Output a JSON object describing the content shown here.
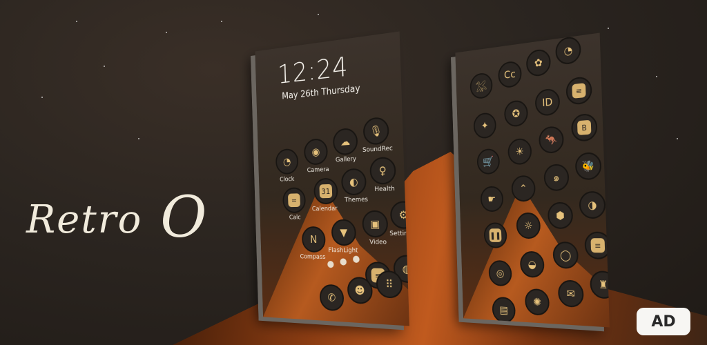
{
  "app_title": "Retro O",
  "title_parts": {
    "word": "Retro",
    "letter": "O"
  },
  "lockscreen": {
    "time": "12:24",
    "date": "May 26th Thursday"
  },
  "phone1_icons": [
    {
      "label": "Clock",
      "icon": "clock-icon"
    },
    {
      "label": "Camera",
      "icon": "camera-icon"
    },
    {
      "label": "Gallery",
      "icon": "gallery-icon"
    },
    {
      "label": "SoundRec",
      "icon": "microphone-icon"
    },
    {
      "label": "Calc",
      "icon": "calculator-icon"
    },
    {
      "label": "Calendar",
      "icon": "calendar-icon"
    },
    {
      "label": "Themes",
      "icon": "themes-icon"
    },
    {
      "label": "Health",
      "icon": "health-icon"
    },
    {
      "label": "Compass",
      "icon": "compass-icon"
    },
    {
      "label": "FlashLight",
      "icon": "flashlight-icon"
    },
    {
      "label": "Video",
      "icon": "video-icon"
    },
    {
      "label": "Setting",
      "icon": "gear-icon"
    }
  ],
  "badge": {
    "label": "AD"
  },
  "colors": {
    "accent": "#d8b26e",
    "icon_bg": "#2b2622",
    "badge_bg": "#f7f6f3"
  }
}
